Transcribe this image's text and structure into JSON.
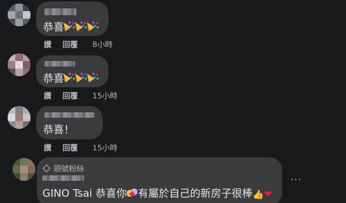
{
  "comments": [
    {
      "text": "恭喜",
      "emojis": [
        "party-popper",
        "party-popper",
        "party-popper"
      ],
      "reply_label": "讚",
      "reply_action": "回覆",
      "time": "8小時"
    },
    {
      "text": "恭喜",
      "emojis": [
        "party-popper",
        "party-popper",
        "party-popper"
      ],
      "reply_label": "讚",
      "reply_action": "回覆",
      "time": "15小時"
    },
    {
      "text": "恭喜！",
      "emojis": [],
      "reply_label": "讚",
      "reply_action": "回覆",
      "time": "15小時"
    },
    {
      "badge": "頭號粉絲",
      "text_part1": "GINO Tsai 恭喜你",
      "text_part2": "有屬於自己的新房子很棒",
      "emojis": [
        "hugging-face",
        "thumbs-up",
        "red-heart"
      ],
      "more_label": "···"
    }
  ],
  "colors": {
    "background": "#18191a",
    "bubble": "#3a3b3c",
    "text": "#e4e6eb",
    "secondary_text": "#b0b3b8"
  }
}
